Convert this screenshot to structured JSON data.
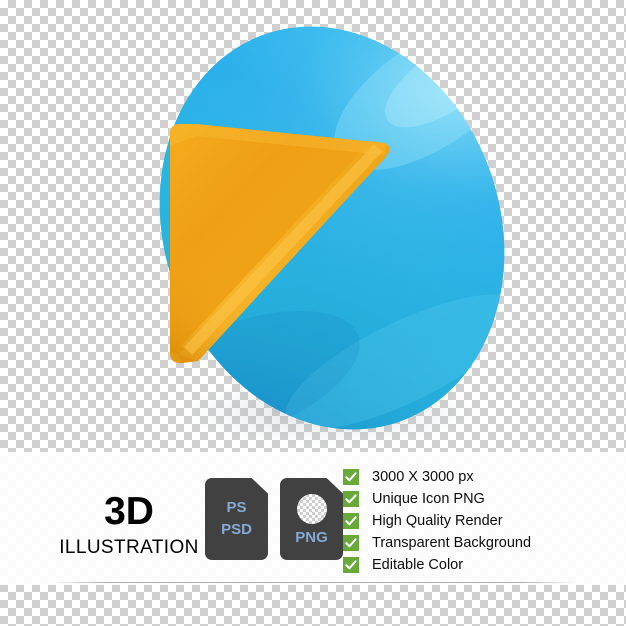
{
  "artwork": {
    "name": "3d-play-button-illustration",
    "description": "3D glossy blue ellipse disc with an orange triangular play arrow",
    "colors": {
      "disc_light": "#3fc6ee",
      "disc_mid": "#23a9e8",
      "disc_teal": "#2bbcd4",
      "disc_shadow": "#1e94c9",
      "arrow_light": "#f9bb2e",
      "arrow_mid": "#f0a21b",
      "arrow_dark": "#e08e0c"
    }
  },
  "banner": {
    "brand": {
      "title": "3D",
      "subtitle": "ILLUSTRATION"
    },
    "badges": [
      {
        "name": "psd-badge",
        "lines": [
          "PS",
          "PSD"
        ],
        "has_swatch": false
      },
      {
        "name": "png-badge",
        "lines": [
          "PNG"
        ],
        "has_swatch": true
      }
    ],
    "features": [
      {
        "label": "3000 X 3000 px"
      },
      {
        "label": "Unique Icon PNG"
      },
      {
        "label": "High Quality Render"
      },
      {
        "label": "Transparent Background"
      },
      {
        "label": "Editable Color"
      }
    ],
    "colors": {
      "check_green": "#68a939",
      "badge_bg": "#414141",
      "badge_text": "#85a9d2",
      "text": "#0d0d0d"
    }
  }
}
